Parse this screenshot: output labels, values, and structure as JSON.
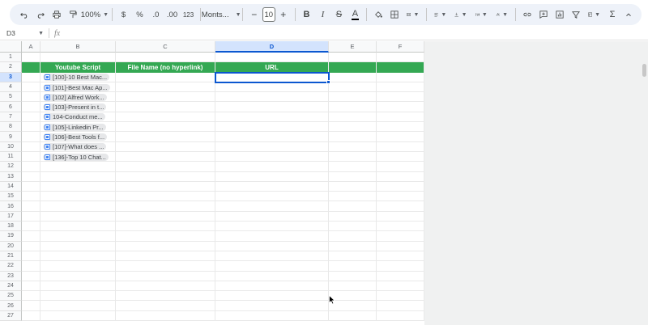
{
  "toolbar": {
    "zoom": "100%",
    "currency": "$",
    "percent": "%",
    "decrease_decimal": ".0",
    "increase_decimal": ".00",
    "number_format": "123",
    "font": "Monts...",
    "font_size": "10",
    "bold": "B",
    "italic": "I",
    "strikethrough": "S",
    "text_color": "A",
    "functions": "Σ"
  },
  "formula_bar": {
    "cell_ref": "D3",
    "fx": "fx",
    "content": ""
  },
  "columns": [
    "A",
    "B",
    "C",
    "D",
    "E",
    "F"
  ],
  "selected_column": "D",
  "selected_row": "3",
  "rows": [
    "1",
    "2",
    "3",
    "4",
    "5",
    "6",
    "7",
    "8",
    "9",
    "10",
    "11",
    "12",
    "13",
    "14",
    "15",
    "16",
    "17",
    "18",
    "19",
    "20",
    "21",
    "22",
    "23",
    "24",
    "25",
    "26",
    "27"
  ],
  "table": {
    "headers": [
      "Youtube Script",
      "File Name (no hyperlink)",
      "URL"
    ],
    "chips": [
      "[100]-10 Best Mac...",
      "[101]-Best Mac Ap...",
      "[102] Alfred Work...",
      "[103]-Present in t...",
      "104-Conduct me...",
      "[105]-Linkedin Pr...",
      "[106]-Best Tools f...",
      "[107]-What does ...",
      "[136]-Top 10 Chat..."
    ]
  },
  "colors": {
    "header_green": "#34a853",
    "selection_blue": "#0b57d0",
    "chip_icon": "#4285f4"
  }
}
